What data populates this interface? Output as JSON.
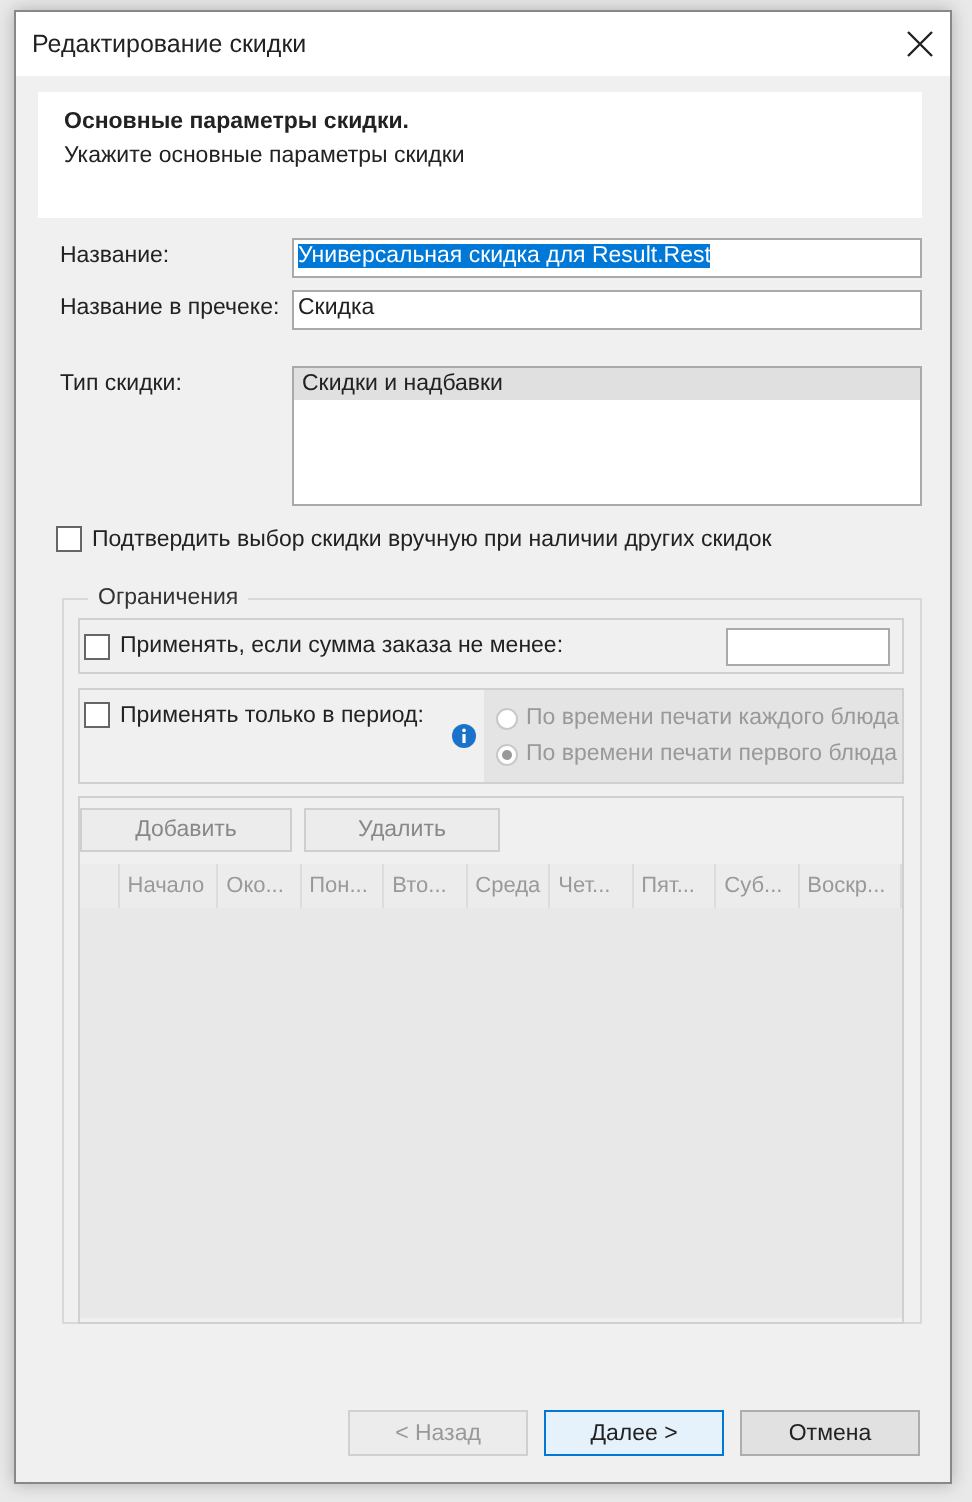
{
  "window": {
    "title": "Редактирование скидки"
  },
  "header": {
    "title": "Основные параметры скидки.",
    "subtitle": "Укажите основные параметры скидки"
  },
  "fields": [
    {
      "label": "Название:",
      "value": "Универсальная скидка для Result.Rest",
      "text_selected": true
    },
    {
      "label": "Название в пречеке:",
      "value": "Скидка",
      "text_selected": false
    }
  ],
  "discount_type": {
    "label": "Тип скидки:",
    "items": [
      {
        "text": "Скидки и надбавки",
        "selected": true
      }
    ]
  },
  "confirm_manually": {
    "label": "Подтвердить выбор скидки вручную при наличии других скидок",
    "checked": false
  },
  "restrictions": {
    "title": "Ограничения",
    "min_sum": {
      "label": "Применять, если сумма заказа не менее:",
      "checked": false
    },
    "period": {
      "label": "Применять только в период:",
      "checked": false,
      "options": [
        {
          "label": "По времени печати каждого блюда",
          "selected": false,
          "disabled": true
        },
        {
          "label": "По времени печати первого блюда",
          "selected": true,
          "disabled": true
        }
      ]
    },
    "buttons": [
      {
        "label": "Добавить",
        "disabled": true
      },
      {
        "label": "Удалить",
        "disabled": true
      }
    ],
    "table": {
      "columns": [
        "Начало",
        "Око...",
        "Пон...",
        "Вто...",
        "Среда",
        "Чет...",
        "Пят...",
        "Суб...",
        "Воскр..."
      ]
    }
  },
  "footer_buttons": [
    {
      "label": "< Назад",
      "disabled": true,
      "default": false
    },
    {
      "label": "Далее >",
      "disabled": false,
      "default": true
    },
    {
      "label": "Отмена",
      "disabled": false,
      "default": false
    }
  ]
}
